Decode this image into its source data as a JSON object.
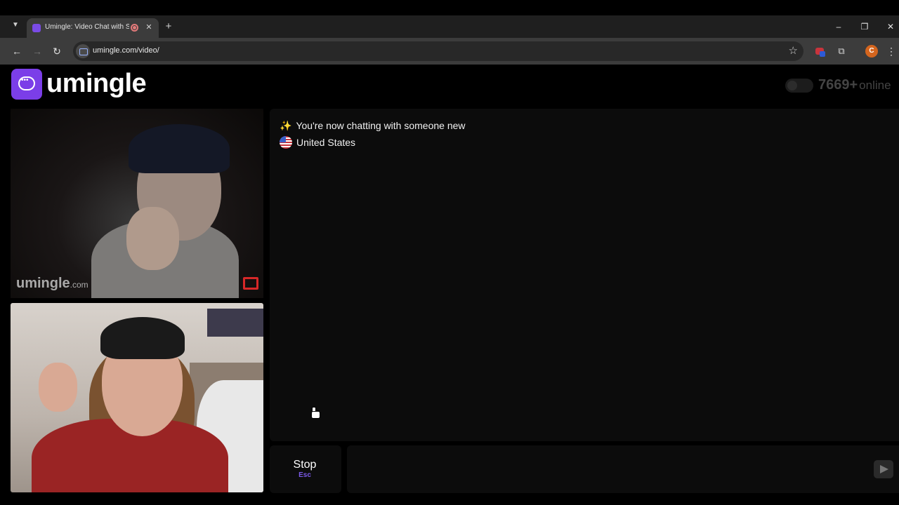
{
  "browser": {
    "tab_title": "Umingle: Video Chat with Strangers",
    "url": "umingle.com/video/",
    "profile_initial": "C"
  },
  "site": {
    "logo_text": "umingle",
    "online_count": "7669+",
    "online_label": "online"
  },
  "stranger_video": {
    "watermark_brand": "umingle",
    "watermark_suffix": ".com"
  },
  "chat": {
    "messages": [
      "You're now chatting with someone new",
      "United States"
    ]
  },
  "controls": {
    "stop_label": "Stop",
    "stop_hint": "Esc",
    "message_placeholder": ""
  },
  "colors": {
    "brand": "#7b3ee8",
    "background": "#000000",
    "panel": "#0c0c0c"
  }
}
